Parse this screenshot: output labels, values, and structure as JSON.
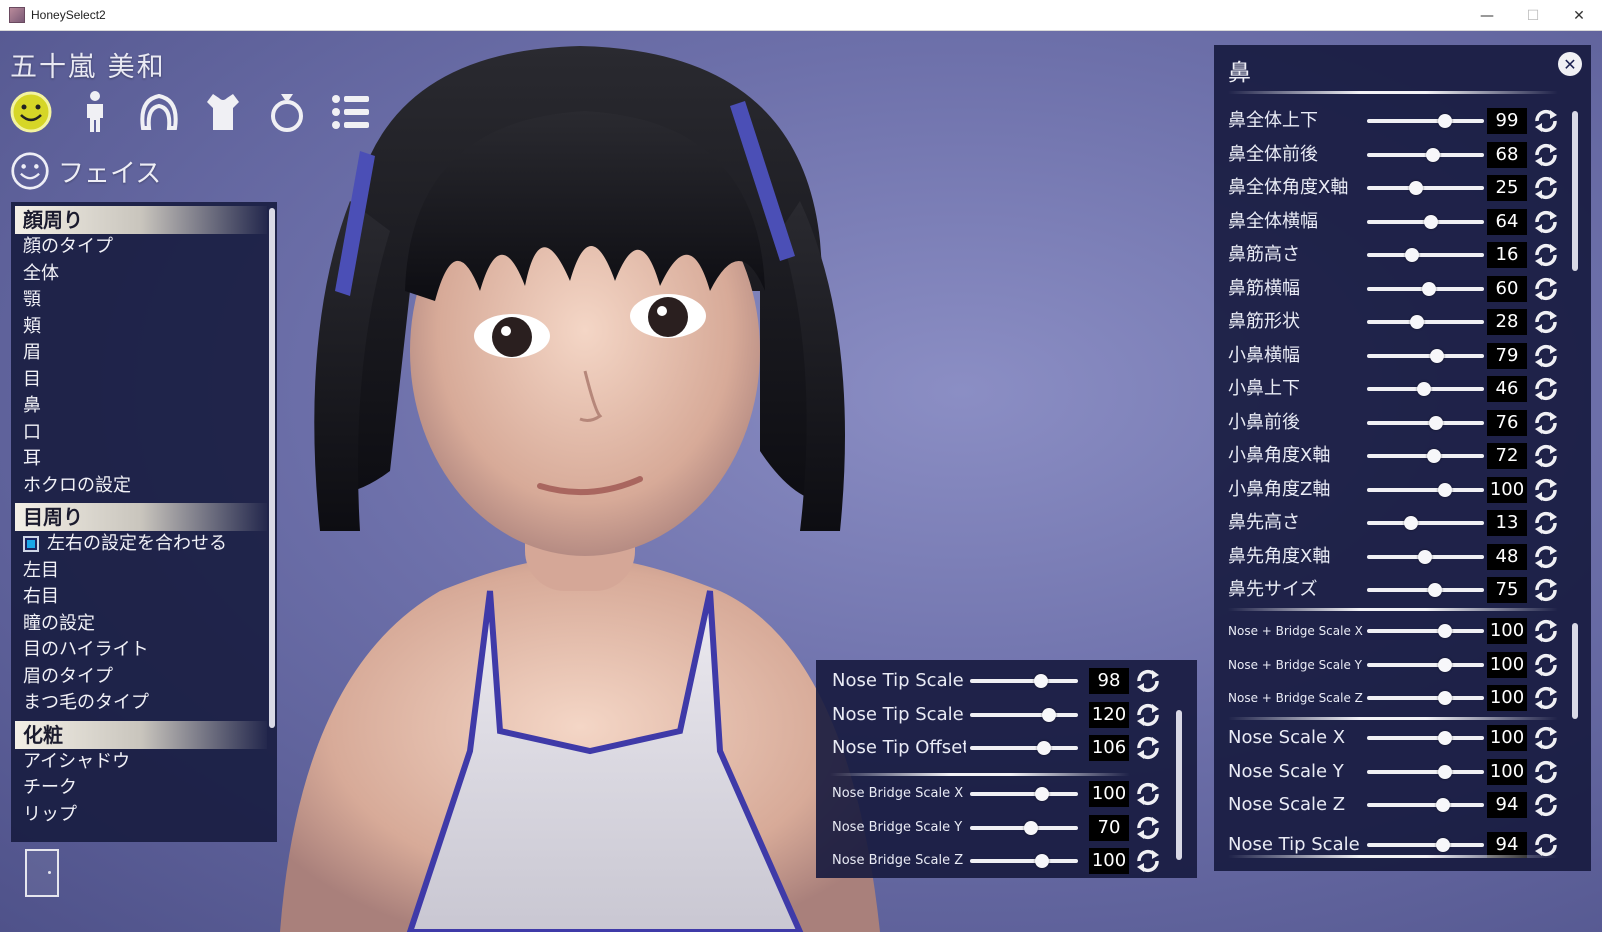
{
  "window": {
    "title": "HoneySelect2",
    "minimize": "—",
    "maximize": "☐",
    "close": "✕"
  },
  "character": {
    "name": "五十嵐 美和"
  },
  "categories": [
    {
      "name": "face-icon",
      "active": true
    },
    {
      "name": "body-icon"
    },
    {
      "name": "hair-icon"
    },
    {
      "name": "clothes-icon"
    },
    {
      "name": "accessory-icon"
    },
    {
      "name": "list-icon"
    }
  ],
  "section": {
    "title": "フェイス"
  },
  "menu": {
    "group1": "顔周り",
    "group1_items": [
      "顔のタイプ",
      "全体",
      "顎",
      "頬",
      "眉",
      "目",
      "鼻",
      "口",
      "耳",
      "ホクロの設定"
    ],
    "group2": "目周り",
    "group2_check": "左右の設定を合わせる",
    "group2_items": [
      "左目",
      "右目",
      "瞳の設定",
      "目のハイライト",
      "眉のタイプ",
      "まつ毛のタイプ"
    ],
    "group3": "化粧",
    "group3_items": [
      "アイシャドウ",
      "チーク",
      "リップ"
    ]
  },
  "nose_panel": {
    "title": "鼻",
    "close": "✕",
    "sliders": [
      {
        "label": "鼻全体上下",
        "value": "99"
      },
      {
        "label": "鼻全体前後",
        "value": "68"
      },
      {
        "label": "鼻全体角度X軸",
        "value": "25"
      },
      {
        "label": "鼻全体横幅",
        "value": "64"
      },
      {
        "label": "鼻筋高さ",
        "value": "16"
      },
      {
        "label": "鼻筋横幅",
        "value": "60"
      },
      {
        "label": "鼻筋形状",
        "value": "28"
      },
      {
        "label": "小鼻横幅",
        "value": "79"
      },
      {
        "label": "小鼻上下",
        "value": "46"
      },
      {
        "label": "小鼻前後",
        "value": "76"
      },
      {
        "label": "小鼻角度X軸",
        "value": "72"
      },
      {
        "label": "小鼻角度Z軸",
        "value": "100"
      },
      {
        "label": "鼻先高さ",
        "value": "13"
      },
      {
        "label": "鼻先角度X軸",
        "value": "48"
      },
      {
        "label": "鼻先サイズ",
        "value": "75"
      }
    ],
    "bridge_sliders": [
      {
        "label": "Nose + Bridge Scale X",
        "value": "100"
      },
      {
        "label": "Nose + Bridge Scale Y",
        "value": "100"
      },
      {
        "label": "Nose + Bridge Scale Z",
        "value": "100"
      }
    ],
    "scale_sliders": [
      {
        "label": "Nose Scale X",
        "value": "100"
      },
      {
        "label": "Nose Scale Y",
        "value": "100"
      },
      {
        "label": "Nose Scale Z",
        "value": "94"
      },
      {
        "label": "Nose Tip Scale X",
        "value": "94"
      }
    ]
  },
  "mid_panel": {
    "sliders": [
      {
        "label": "Nose Tip Scale Y",
        "value": "98"
      },
      {
        "label": "Nose Tip Scale Z",
        "value": "120"
      },
      {
        "label": "Nose Tip Offset",
        "value": "106"
      }
    ],
    "bridge_sliders": [
      {
        "label": "Nose Bridge Scale X",
        "value": "100"
      },
      {
        "label": "Nose Bridge Scale Y",
        "value": "70"
      },
      {
        "label": "Nose Bridge Scale Z",
        "value": "100"
      }
    ]
  }
}
